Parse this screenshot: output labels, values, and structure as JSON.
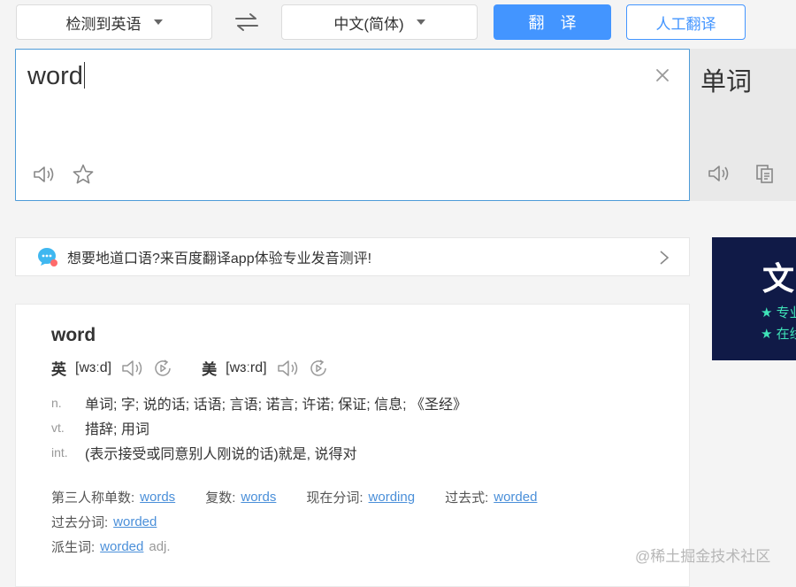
{
  "topbar": {
    "source_lang": "检测到英语",
    "target_lang": "中文(简体)",
    "translate_label": "翻译",
    "human_label": "人工翻译"
  },
  "input": {
    "text": "word"
  },
  "output": {
    "text": "单词"
  },
  "promo": {
    "text": "想要地道口语?来百度翻译app体验专业发音测评!"
  },
  "ad": {
    "big": "文",
    "line1": "★ 专业",
    "line2": "★ 在线"
  },
  "dict": {
    "headword": "word",
    "uk_label": "英",
    "uk_phonetic": "[wɜːd]",
    "us_label": "美",
    "us_phonetic": "[wɜːrd]",
    "meanings": [
      {
        "pos": "n.",
        "text": "单词;  字;  说的话;  话语;  言语;  诺言;  许诺;  保证;  信息;  《圣经》"
      },
      {
        "pos": "vt.",
        "text": "措辞;  用词"
      },
      {
        "pos": "int.",
        "text": "(表示接受或同意别人刚说的话)就是, 说得对"
      }
    ],
    "forms": {
      "third_label": "第三人称单数:",
      "third_value": "words",
      "plural_label": "复数:",
      "plural_value": "words",
      "present_label": "现在分词:",
      "present_value": "wording",
      "past_label": "过去式:",
      "past_value": "worded",
      "pp_label": "过去分词:",
      "pp_value": "worded",
      "derived_label": "派生词:",
      "derived_value": "worded",
      "derived_pos": "adj."
    }
  },
  "watermark": "@稀土掘金技术社区"
}
